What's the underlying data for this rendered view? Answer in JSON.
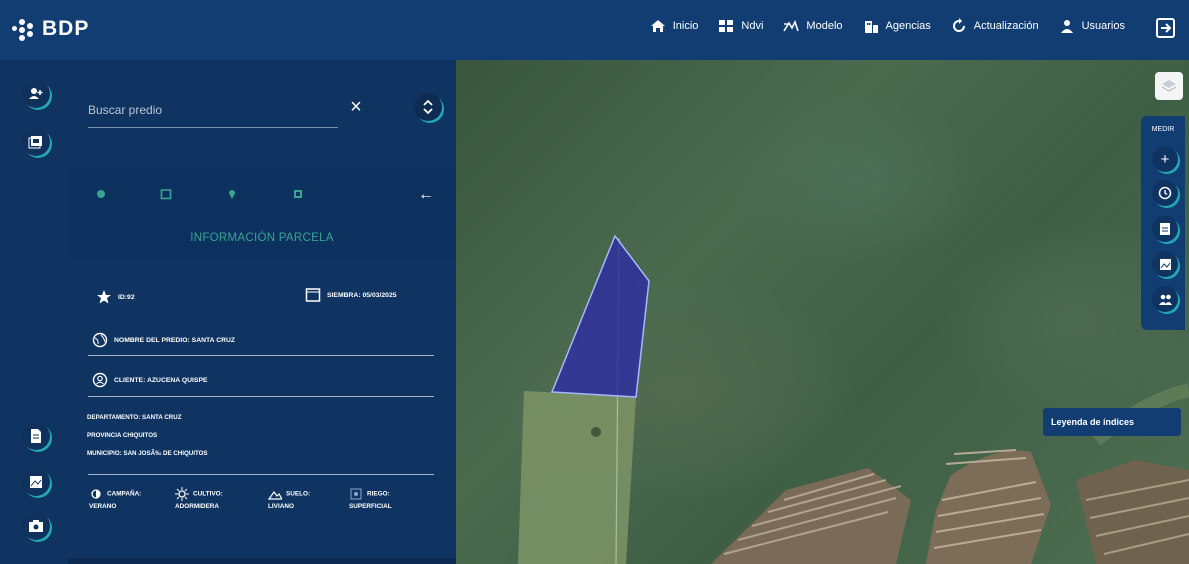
{
  "brand": {
    "name": "BDP"
  },
  "nav": [
    {
      "label": "Inicio",
      "icon": "home-icon"
    },
    {
      "label": "Ndvi",
      "icon": "grid-icon"
    },
    {
      "label": "Modelo",
      "icon": "model-icon"
    },
    {
      "label": "Agencias",
      "icon": "building-icon"
    },
    {
      "label": "Actualización",
      "icon": "refresh-icon"
    },
    {
      "label": "Usuarios",
      "icon": "user-icon"
    }
  ],
  "search": {
    "placeholder": "Buscar predio",
    "value": ""
  },
  "panel": {
    "section_title": "INFORMACIÓN PARCELA",
    "id": "ID:92",
    "siembra": "SIEMBRA: 05/03/2025",
    "predio": "NOMBRE DEL PREDIO: SANTA CRUZ",
    "cliente": "CLIENTE: AZUCENA QUISPE",
    "departamento": "DEPARTAMENTO: SANTA CRUZ",
    "provincia": "PROVINCIA CHIQUITOS",
    "municipio": "MUNICIPIO: SAN JOSÃ‰ DE CHIQUITOS",
    "campana_label": "CAMPAÑA:",
    "campana_value": "VERANO",
    "cultivo_label": "CULTIVO:",
    "cultivo_value": "ADORMIDERA",
    "suelo_label": "SUELO:",
    "suelo_value": "LIVIANO",
    "riego_label": "RIEGO:",
    "riego_value": "SUPERFICIAL"
  },
  "map": {
    "measure_label": "MEDIR",
    "legend_button": "Leyenda de índices"
  },
  "colors": {
    "navy": "#123d73",
    "panel": "#0f3462",
    "accent": "#24a7b5",
    "green": "#37a58f",
    "parcel": "#2f2f9e"
  }
}
